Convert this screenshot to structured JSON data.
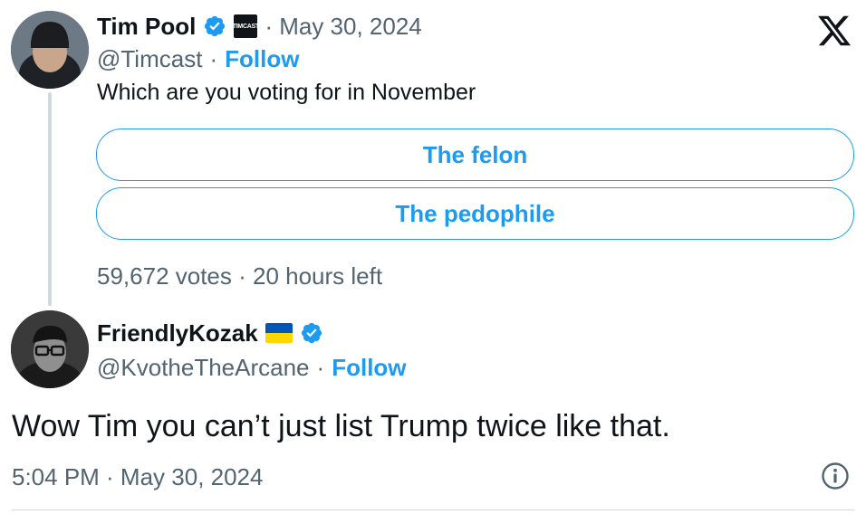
{
  "tweet": {
    "author_name": "Tim Pool",
    "affiliate_badge_text": "TIMCAST",
    "date": "· May 30, 2024",
    "handle": "@Timcast",
    "separator": "·",
    "follow_label": "Follow",
    "text": "Which are you voting for in November",
    "poll": {
      "options": [
        "The felon",
        "The pedophile"
      ],
      "footer": "59,672 votes · 20 hours left"
    }
  },
  "reply": {
    "author_name": "FriendlyKozak",
    "handle": "@KvotheTheArcane",
    "separator": "·",
    "follow_label": "Follow",
    "text": "Wow Tim you can’t just list Trump twice like that.",
    "timestamp": "5:04 PM · May 30, 2024"
  },
  "icons": {
    "verified": "verified-badge-icon",
    "logo": "x-logo-icon",
    "flag": "ukraine-flag-icon",
    "info": "info-icon"
  },
  "colors": {
    "accent": "#1d9bf0",
    "text": "#0f1419",
    "muted": "#536471",
    "flag_blue": "#0057b7",
    "flag_yellow": "#ffd700"
  }
}
